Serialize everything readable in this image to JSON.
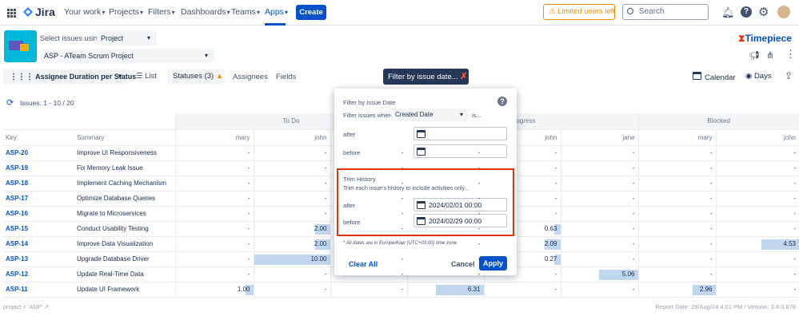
{
  "nav": {
    "brand": "Jira",
    "your_work": "Your work",
    "projects": "Projects",
    "filters": "Filters",
    "dashboards": "Dashboards",
    "teams": "Teams",
    "apps": "Apps",
    "create": "Create",
    "limited": "Limited users left",
    "search_placeholder": "Search"
  },
  "app": {
    "select_label": "Select issues using",
    "select_value": "Project",
    "project_value": "ASP - ATeam Scrum Project",
    "brand_name": "Timepiece"
  },
  "toolbar": {
    "report": "Assignee Duration per Status",
    "list": "List",
    "statuses": "Statuses (3)",
    "assignees": "Assignees",
    "fields": "Fields",
    "filter": "Filter by issue date...",
    "calendar": "Calendar",
    "days": "Days"
  },
  "issues_label": "Issues: 1 - 10 / 20",
  "groups": [
    "To Do",
    "Progress",
    "Blocked"
  ],
  "columns": {
    "key": "Key",
    "summary": "Summary",
    "todo": [
      "mary",
      "john"
    ],
    "progress_visible": [
      "john",
      "jane"
    ],
    "blocked": [
      "mary",
      "john"
    ]
  },
  "rows": [
    {
      "key": "ASP-20",
      "summary": "Improve UI Responsiveness",
      "vals": [
        "-",
        "-",
        "-",
        "-",
        "-",
        "-",
        "-",
        "-"
      ]
    },
    {
      "key": "ASP-19",
      "summary": "Fix Memory Leak Issue",
      "vals": [
        "-",
        "-",
        "-",
        "-",
        "-",
        "-",
        "-",
        "-"
      ]
    },
    {
      "key": "ASP-18",
      "summary": "Implement Caching Mechanism",
      "vals": [
        "-",
        "-",
        "-",
        "-",
        "-",
        "-",
        "-",
        "-"
      ]
    },
    {
      "key": "ASP-17",
      "summary": "Optimize Database Queries",
      "vals": [
        "-",
        "-",
        "-",
        "-",
        "-",
        "-",
        "-",
        "-"
      ]
    },
    {
      "key": "ASP-16",
      "summary": "Migrate to Microservices",
      "vals": [
        "-",
        "-",
        "-",
        "-",
        "-",
        "-",
        "-",
        "-"
      ]
    },
    {
      "key": "ASP-15",
      "summary": "Conduct Usability Testing",
      "vals": [
        "-",
        "2.00",
        "-",
        "-",
        "0.63",
        "-",
        "-",
        "-"
      ]
    },
    {
      "key": "ASP-14",
      "summary": "Improve Data Visualization",
      "vals": [
        "-",
        "2.00",
        "-",
        "-",
        "2.09",
        "-",
        "-",
        "4.53"
      ]
    },
    {
      "key": "ASP-13",
      "summary": "Upgrade Database Driver",
      "vals": [
        "-",
        "10.00",
        "-",
        "-",
        "0.27",
        "-",
        "-",
        "-"
      ]
    },
    {
      "key": "ASP-12",
      "summary": "Update Real-Time Data",
      "vals": [
        "-",
        "-",
        "-",
        "-",
        "-",
        "5.06",
        "-",
        "-"
      ]
    },
    {
      "key": "ASP-11",
      "summary": "Update UI Framework",
      "vals": [
        "1.00",
        "-",
        "-",
        "6.31",
        "-",
        "-",
        "2.96",
        "-"
      ]
    }
  ],
  "popup": {
    "title": "Filter by Issue Date",
    "where_label": "Filter issues where",
    "where_value": "Created Date",
    "is": "is...",
    "after": "after",
    "before": "before",
    "trim_title": "Trim History",
    "trim_desc": "Trim each issue's history to include activities only...",
    "trim_after_value": "2024/02/01 00:00",
    "trim_before_value": "2024/02/29 00:00",
    "note": "* All dates are in Europe/Kiev (UTC+03:00) time zone.",
    "clear": "Clear All",
    "cancel": "Cancel",
    "apply": "Apply"
  },
  "footer": {
    "jql": "project = 'ASP'",
    "report_date": "Report Date: 28/Aug/24 4:01 PM / Version: 3.4.0.878"
  },
  "colors": {
    "primary": "#0052cc",
    "highlight_border": "#de350b",
    "bar": "#c1d7ef",
    "warning": "#ff8b00"
  }
}
